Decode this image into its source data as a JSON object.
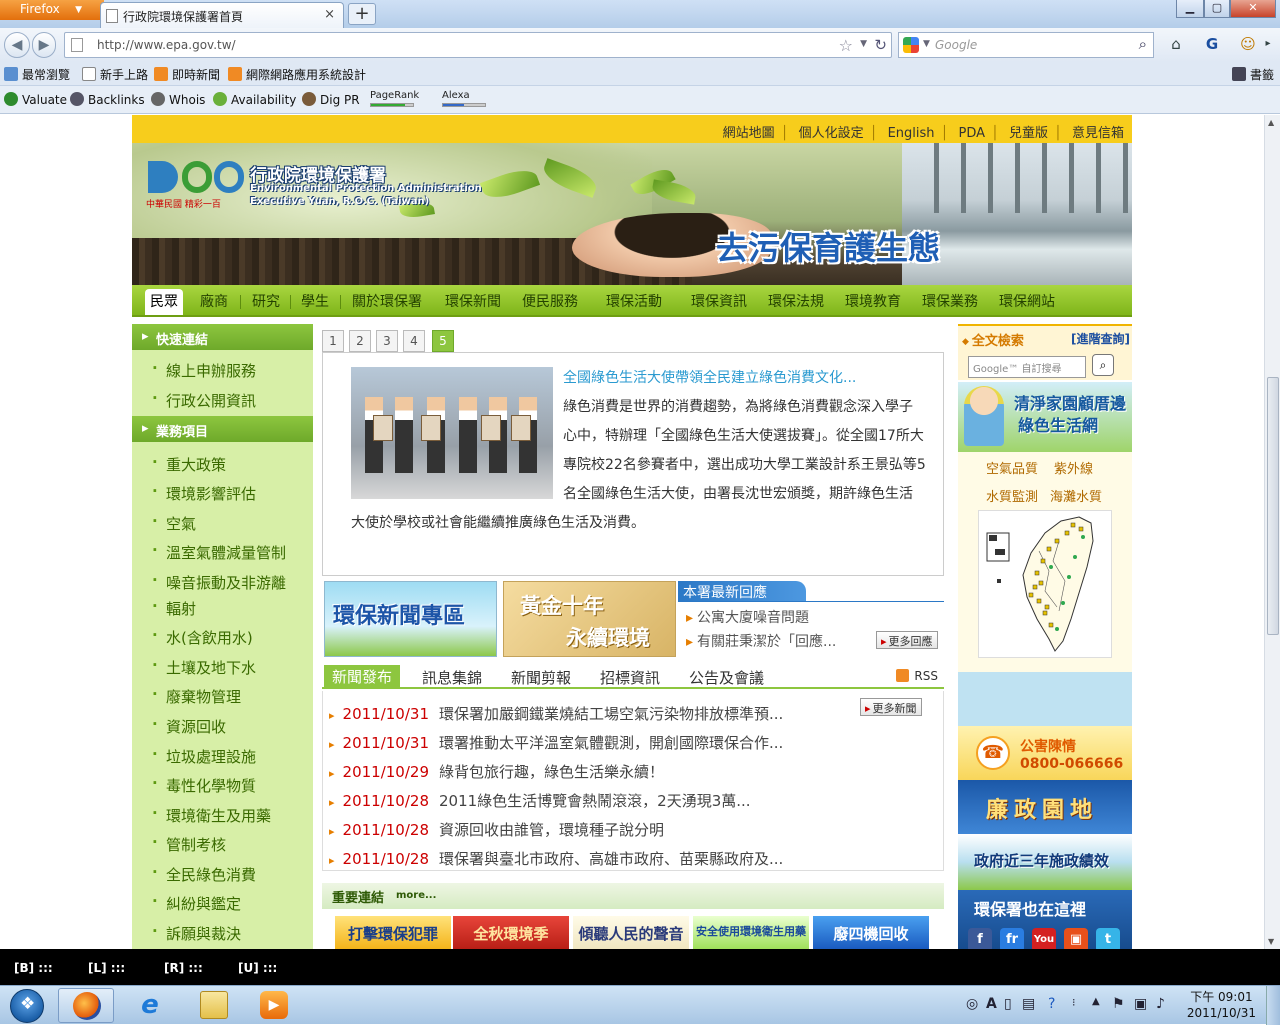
{
  "browser": {
    "app_button": "Firefox",
    "tab_title": "行政院環境保護署首頁",
    "tab_close": "×",
    "new_tab": "+",
    "win_min": "▁",
    "win_max": "▢",
    "win_close": "✕",
    "url": "http://www.epa.gov.tw/",
    "search_placeholder": "Google",
    "bookmarks": [
      "最常瀏覽",
      "新手上路",
      "即時新聞",
      "網際網路應用系統設計"
    ],
    "bookmarks_menu": "書籤",
    "seo_tools": [
      "Valuate",
      "Backlinks",
      "Whois",
      "Availability",
      "Dig PR"
    ],
    "pagerank_label": "PageRank",
    "alexa_label": "Alexa",
    "pagerank_level": 0.8,
    "alexa_level": 0.5
  },
  "site": {
    "top_links": [
      "網站地圖",
      "個人化設定",
      "English",
      "PDA",
      "兒童版",
      "意見信箱"
    ],
    "logo_caption": "中華民國 精彩一百",
    "org_zh": "行政院環境保護署",
    "org_en_1": "Environmental Protection Administration",
    "org_en_2": "Executive Yuan, R.O.C. (Taiwan)",
    "slogan": "去污保育護生態",
    "nav": [
      "民眾",
      "廠商",
      "研究",
      "學生",
      "關於環保署",
      "環保新聞",
      "便民服務",
      "環保活動",
      "環保資訊",
      "環保法規",
      "環境教育",
      "環保業務",
      "環保網站"
    ],
    "left": {
      "quick_title": "快速連結",
      "quick_items": [
        "線上申辦服務",
        "行政公開資訊"
      ],
      "biz_title": "業務項目",
      "biz_items": [
        "重大政策",
        "環境影響評估",
        "空氣",
        "溫室氣體減量管制",
        "噪音振動及非游離",
        "輻射",
        "水(含飲用水)",
        "土壤及地下水",
        "廢棄物管理",
        "資源回收",
        "垃圾處理設施",
        "毒性化學物質",
        "環境衛生及用藥",
        "管制考核",
        "全民綠色消費",
        "糾紛與鑑定",
        "訴願與裁決"
      ]
    },
    "feature": {
      "tabs": [
        "1",
        "2",
        "3",
        "4",
        "5"
      ],
      "active_tab": "5",
      "title": "全國綠色生活大使帶領全民建立綠色消費文化...",
      "body": "綠色消費是世界的消費趨勢，為將綠色消費觀念深入學子心中，特辦理「全國綠色生活大使選拔賽」。從全國17所大專院校22名參賽者中，選出成功大學工業設計系王景弘等5名全國綠色生活大使，由署長沈世宏頒獎，期許綠色生活大使於學校或社會能繼續推廣綠色生活及消費。"
    },
    "promo_news": "環保新聞專區",
    "promo_gold_1": "黃金十年",
    "promo_gold_2": "永續環境",
    "replies": {
      "title": "本署最新回應",
      "items": [
        "公寓大廈噪音問題",
        "有關莊秉潔於「回應..."
      ],
      "more": "更多回應"
    },
    "news_tabs": [
      "新聞發布",
      "訊息集錦",
      "新聞剪報",
      "招標資訊",
      "公告及會議"
    ],
    "rss": "RSS",
    "news_more": "更多新聞",
    "news": [
      {
        "date": "2011/10/31",
        "title": "環保署加嚴鋼鐵業燒結工場空氣污染物排放標準預..."
      },
      {
        "date": "2011/10/31",
        "title": "環署推動太平洋溫室氣體觀測，開創國際環保合作..."
      },
      {
        "date": "2011/10/29",
        "title": "綠背包旅行趣，綠色生活樂永續！"
      },
      {
        "date": "2011/10/28",
        "title": "2011綠色生活博覽會熱鬧滾滾，2天湧現3萬..."
      },
      {
        "date": "2011/10/28",
        "title": "資源回收由誰管，環境種子說分明"
      },
      {
        "date": "2011/10/28",
        "title": "環保署與臺北市政府、高雄市政府、苗栗縣政府及..."
      }
    ],
    "links_title": "重要連結",
    "links_more": "more...",
    "link_banners": [
      "打擊環保犯罪",
      "全秋環境季",
      "傾聽人民的聲音",
      "安全使用環境衛生用藥",
      "廢四機回收"
    ],
    "right": {
      "search_title": "全文檢索",
      "search_adv": "[進階查詢]",
      "search_placeholder": "Google™ 自訂搜尋",
      "clean_1": "清淨家園顧厝邊",
      "clean_2": "綠色生活網",
      "monitor": [
        "空氣品質",
        "紫外線",
        "水質監測",
        "海灘水質"
      ],
      "hotline_title": "公害陳情",
      "hotline_number": "0800-066666",
      "integrity": "廉政園地",
      "perf": "政府近三年施政績效",
      "social": "環保署也在這裡",
      "social_icons": [
        "f",
        "fr",
        "You",
        "▣",
        "t"
      ]
    }
  },
  "statusbar": [
    "[B] :::",
    "[L] :::",
    "[R] :::",
    "[U] :::"
  ],
  "taskbar": {
    "time": "下午 09:01",
    "date": "2011/10/31"
  },
  "colors": {
    "brand_green": "#8dc63f",
    "top_yellow": "#f7cd1c",
    "news_date_red": "#cc0000",
    "link_blue": "#2a9ad0"
  }
}
